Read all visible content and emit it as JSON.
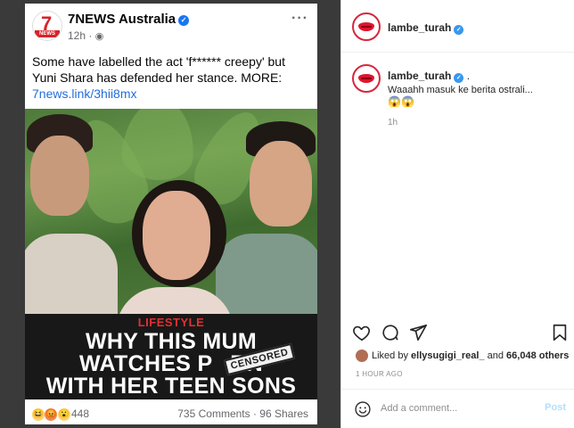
{
  "facebook_post": {
    "page_name": "7NEWS Australia",
    "logo_number": "7",
    "logo_word": "NEWS",
    "time": "12h · ",
    "text": "Some have labelled the act 'f****** creepy' but Yuni Shara has defended her stance. MORE:",
    "link": "7news.link/3hii8mx",
    "banner": {
      "tag": "LIFESTYLE",
      "line1": "WHY THIS MUM",
      "line2": "WATCHES P",
      "line2_end": "RN",
      "line3": "WITH HER TEEN SONS",
      "stamp": "CENSORED"
    },
    "reactions": {
      "emojis": [
        "😆",
        "😡",
        "😮"
      ],
      "count": "448"
    },
    "stats": "735 Comments · 96 Shares"
  },
  "instagram": {
    "header": {
      "username": "lambe_turah"
    },
    "caption": {
      "username": "lambe_turah",
      "after_verified": " .",
      "text": "Waaahh masuk ke berita ostrali...",
      "emoji": "😱😱",
      "time": "1h"
    },
    "likes": {
      "prefix": "Liked by ",
      "user": "ellysugigi_real_",
      "middle": " and ",
      "count": "66,048 others"
    },
    "time_ago": "1 HOUR AGO",
    "comment_placeholder": "Add a comment...",
    "post_label": "Post",
    "icons": [
      "heart-icon",
      "comment-icon",
      "share-icon",
      "bookmark-icon",
      "smile-icon"
    ]
  },
  "colors": {
    "fb_link": "#216fdb",
    "fb_verified": "#1877f2",
    "ig_verified": "#3897f0",
    "banner_tag": "#e03134",
    "ig_post_disabled": "#b2dffc"
  }
}
